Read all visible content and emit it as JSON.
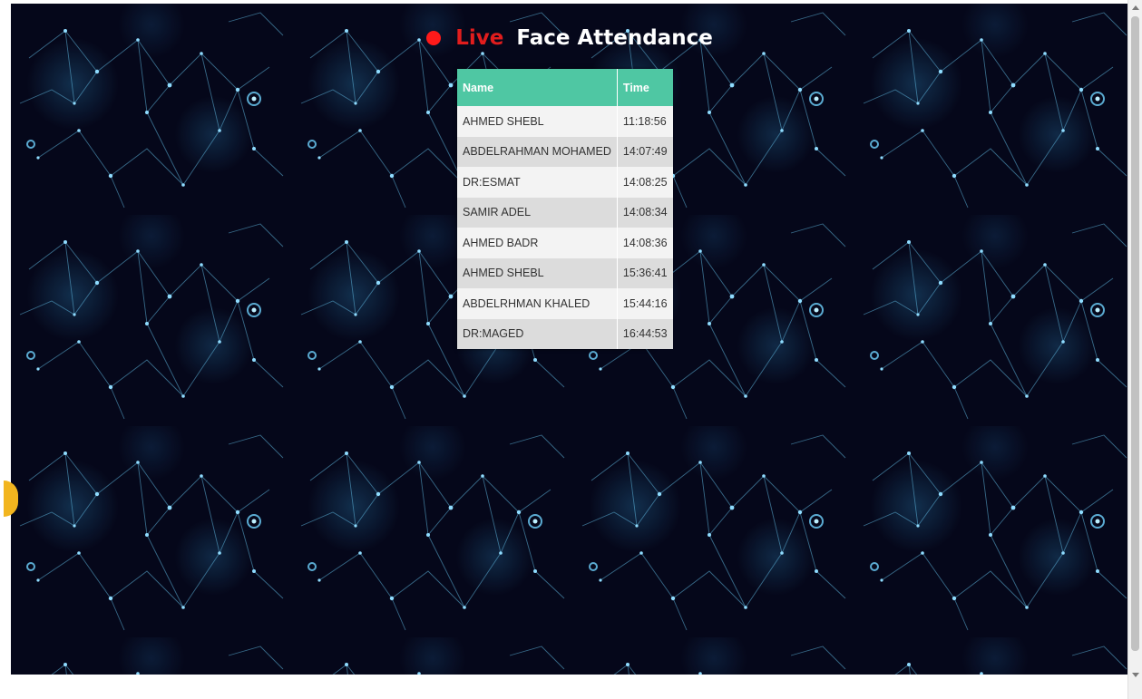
{
  "header": {
    "live_label": "Live",
    "title": "Face Attendance"
  },
  "table": {
    "columns": [
      "Name",
      "Time"
    ],
    "rows": [
      {
        "name": "AHMED SHEBL",
        "time": "11:18:56"
      },
      {
        "name": "ABDELRAHMAN MOHAMED",
        "time": "14:07:49"
      },
      {
        "name": "DR:ESMAT",
        "time": "14:08:25"
      },
      {
        "name": "SAMIR ADEL",
        "time": "14:08:34"
      },
      {
        "name": "AHMED BADR",
        "time": "14:08:36"
      },
      {
        "name": "AHMED SHEBL",
        "time": "15:36:41"
      },
      {
        "name": "ABDELRHMAN KHALED",
        "time": "15:44:16"
      },
      {
        "name": "DR:MAGED",
        "time": "16:44:53"
      }
    ]
  },
  "colors": {
    "live_dot": "#ff1a1a",
    "live_text": "#e11d1d",
    "header_bg": "#4fc7a3",
    "background": "#05071a"
  },
  "icons": {
    "live_indicator": "red-dot-icon",
    "background": "network-constellation-pattern"
  }
}
